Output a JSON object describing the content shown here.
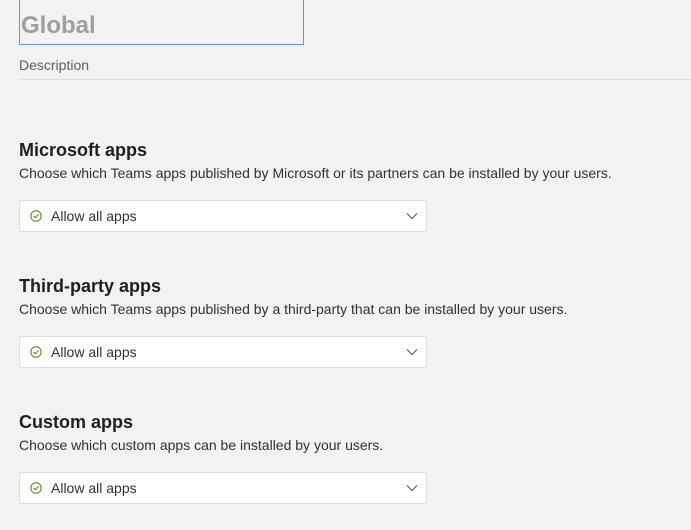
{
  "policy": {
    "name_placeholder": "Global",
    "name_value": "",
    "description_label": "Description"
  },
  "sections": [
    {
      "title": "Microsoft apps",
      "description": "Choose which Teams apps published by Microsoft or its partners can be installed by your users.",
      "selected": "Allow all apps"
    },
    {
      "title": "Third-party apps",
      "description": "Choose which Teams apps published by a third-party that can be installed by your users.",
      "selected": "Allow all apps"
    },
    {
      "title": "Custom apps",
      "description": "Choose which custom apps can be installed by your users.",
      "selected": "Allow all apps"
    }
  ],
  "colors": {
    "background": "#f3f2f1",
    "check": "#498205",
    "input_border": "#5b9bd5"
  },
  "icons": {
    "status": "check-circle-icon",
    "dropdown": "chevron-down-icon"
  }
}
